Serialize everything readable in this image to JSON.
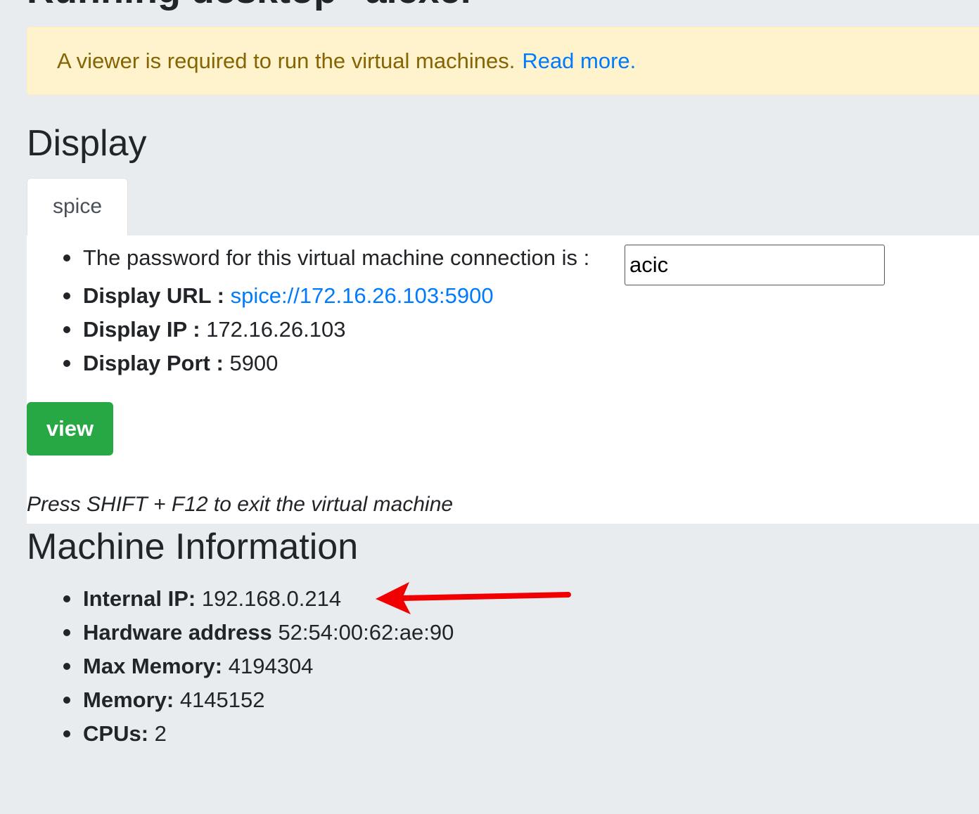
{
  "page": {
    "title": "Running desktop \"alexel\""
  },
  "alert": {
    "message": "A viewer is required to run the virtual machines.",
    "link_text": "Read more."
  },
  "display": {
    "heading": "Display",
    "tabs": [
      {
        "label": "spice",
        "active": true
      }
    ],
    "password_label": "The password for this virtual machine connection is :",
    "password_value": "acic",
    "url_label": "Display URL :",
    "url_value": "spice://172.16.26.103:5900",
    "ip_label": "Display IP :",
    "ip_value": "172.16.26.103",
    "port_label": "Display Port :",
    "port_value": "5900",
    "view_button": "view",
    "hint": "Press SHIFT + F12 to exit the virtual machine"
  },
  "machine": {
    "heading": "Machine Information",
    "items": [
      {
        "label": "Internal IP:",
        "value": "192.168.0.214"
      },
      {
        "label": "Hardware address",
        "value": "52:54:00:62:ae:90"
      },
      {
        "label": "Max Memory:",
        "value": "4194304"
      },
      {
        "label": "Memory:",
        "value": "4145152"
      },
      {
        "label": "CPUs:",
        "value": "2"
      }
    ]
  },
  "annotation": {
    "arrow_color": "#f00000",
    "arrow_icon": "arrow-left-icon"
  },
  "colors": {
    "alert_bg": "#fff3cd",
    "alert_text": "#856404",
    "link": "#007bff",
    "button_green": "#28a745",
    "page_bg": "#e9ecef"
  }
}
